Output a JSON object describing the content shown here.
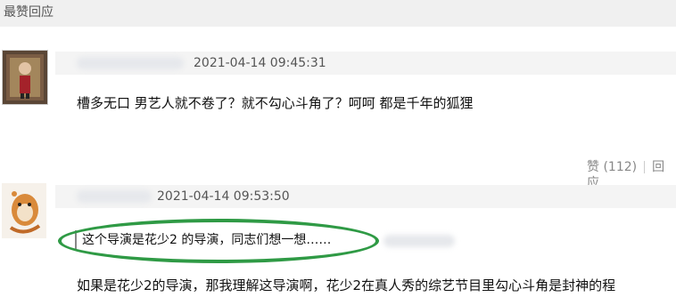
{
  "section": {
    "title": "最赞回应"
  },
  "comments": [
    {
      "timestamp": "2021-04-14 09:45:31",
      "text": "槽多无口 男艺人就不卷了？就不勾心斗角了？呵呵 都是千年的狐狸",
      "like_label": "赞 (112)",
      "reply_label": "回应"
    },
    {
      "timestamp": "2021-04-14 09:53:50",
      "quote": "这个导演是花少2 的导演，同志们想一想……",
      "text": "如果是花少2的导演，那我理解这导演啊，花少2在真人秀的综艺节目里勾心斗角是封神的程"
    }
  ],
  "colors": {
    "highlight": "#2f9a45",
    "header_bg": "#f0f0f0"
  }
}
